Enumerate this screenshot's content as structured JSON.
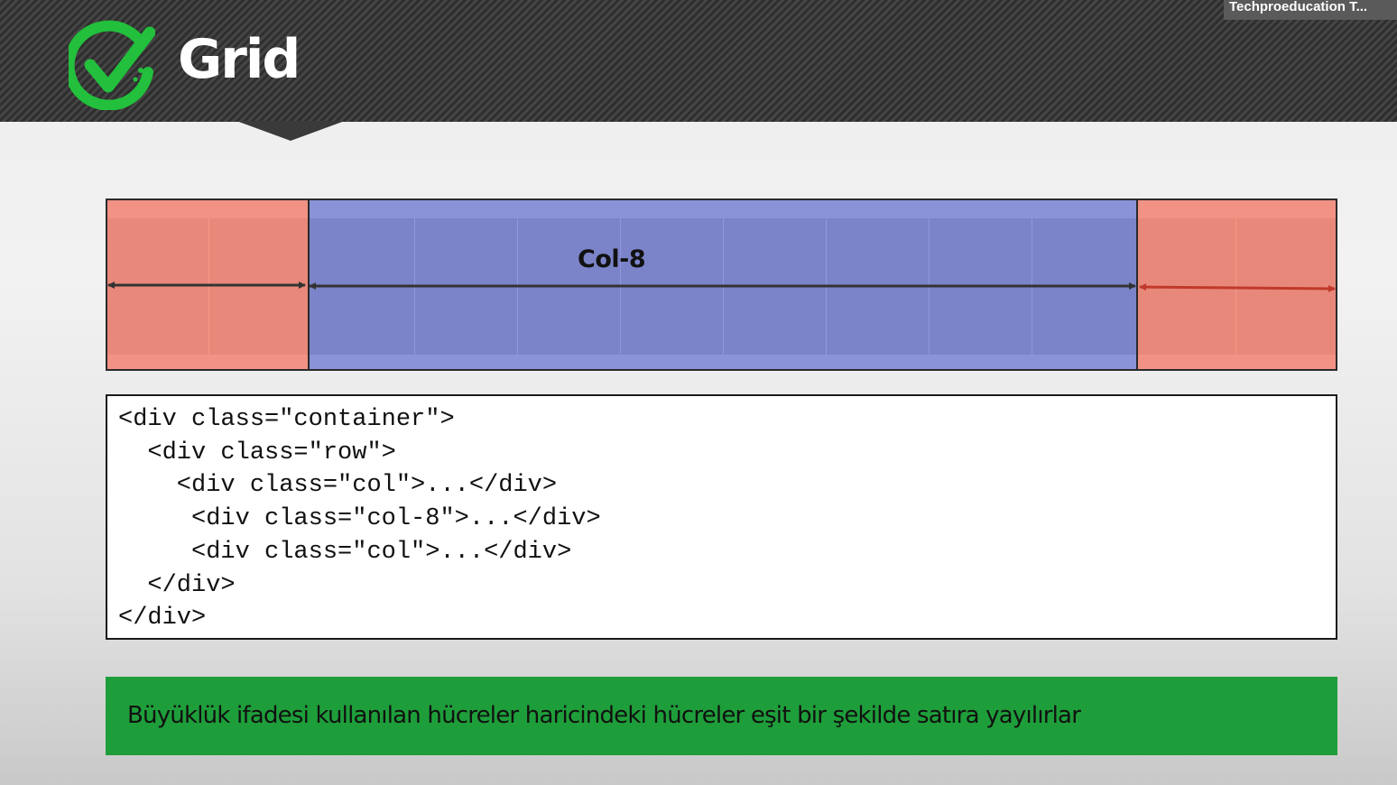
{
  "header": {
    "title": "Grid",
    "logo_icon": "check-circle-icon",
    "presenter_name": "Techproeducation T..."
  },
  "grid_demo": {
    "center_label": "Col-8",
    "colors": {
      "side_columns": "#e8887a",
      "center_column": "#7b84c9",
      "left_arrow": "#333333",
      "center_arrow": "#333333",
      "right_arrow": "#c0392b"
    }
  },
  "code": {
    "lines": [
      "<div class=\"container\">",
      "  <div class=\"row\">",
      "    <div class=\"col\">...</div>",
      "     <div class=\"col-8\">...</div>",
      "     <div class=\"col\">...</div>",
      "  </div>",
      "</div>"
    ]
  },
  "note": {
    "text": "Büyüklük ifadesi kullanılan hücreler haricindeki hücreler eşit bir şekilde satıra yayılırlar",
    "background": "#1e9e3a"
  }
}
